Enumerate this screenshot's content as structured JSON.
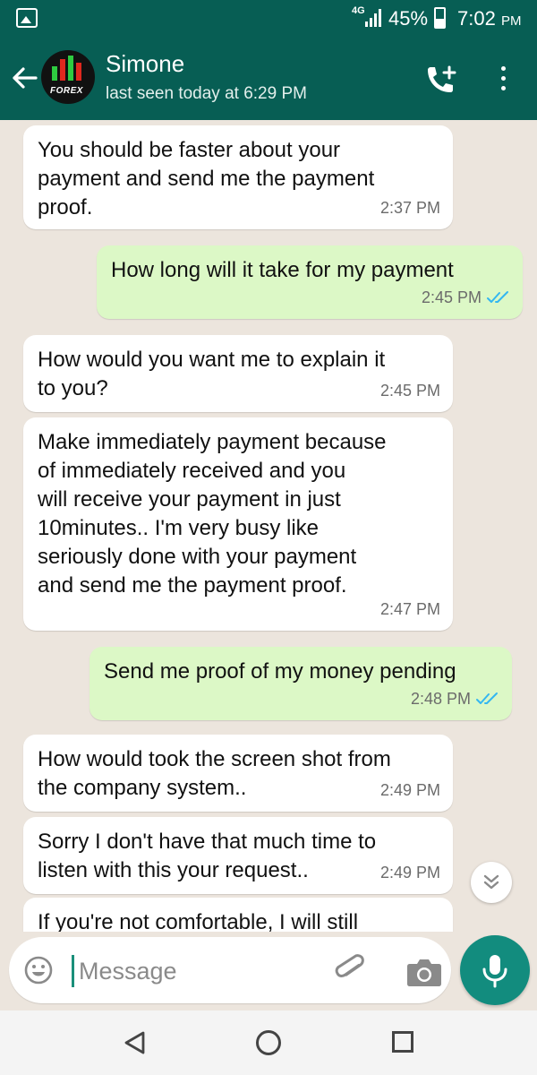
{
  "status_bar": {
    "network": "4G",
    "battery": "45%",
    "time": "7:02",
    "time_suffix": "PM"
  },
  "header": {
    "contact_name": "Simone",
    "last_seen": "last seen today at 6:29 PM",
    "avatar_text": "FOREX"
  },
  "messages": [
    {
      "direction": "in",
      "lines": [
        "You should be faster about your",
        "payment and send me the payment",
        "proof."
      ],
      "time": "2:37 PM"
    },
    {
      "direction": "out",
      "lines": [
        "How long will it take for my payment"
      ],
      "time": "2:45 PM",
      "status": "read"
    },
    {
      "direction": "in",
      "lines": [
        "How would you want me to explain it",
        "to you?"
      ],
      "time": "2:45 PM"
    },
    {
      "direction": "in",
      "lines": [
        "Make immediately payment because",
        "of immediately received and you",
        "will receive your payment in just",
        "10minutes.. I'm very busy like",
        "seriously done with your payment",
        "and send me the payment proof."
      ],
      "time": "2:47 PM"
    },
    {
      "direction": "out",
      "lines": [
        "Send me proof of my money pending"
      ],
      "time": "2:48 PM",
      "status": "read"
    },
    {
      "direction": "in",
      "lines": [
        "How would took the screen shot from",
        "the company system.."
      ],
      "time": "2:49 PM"
    },
    {
      "direction": "in",
      "lines": [
        "Sorry I don't have that much time to",
        "listen with this your request.."
      ],
      "time": "2:49 PM"
    },
    {
      "direction": "in",
      "lines": [
        "If you're not comfortable, I will still"
      ],
      "time": ""
    }
  ],
  "composer": {
    "placeholder": "Message"
  },
  "colors": {
    "header": "#075e54",
    "outgoing_bubble": "#dcf8c6",
    "incoming_bubble": "#ffffff",
    "chat_background": "#ece5dd",
    "accent": "#128c7e",
    "read_ticks": "#34b7f1"
  },
  "icons": [
    "image-icon",
    "signal-icon",
    "battery-icon",
    "back-arrow-icon",
    "add-call-icon",
    "more-vert-icon",
    "double-check-icon",
    "chevrons-down-icon",
    "emoji-icon",
    "attach-icon",
    "camera-icon",
    "mic-icon",
    "nav-back-icon",
    "nav-home-icon",
    "nav-recents-icon"
  ]
}
